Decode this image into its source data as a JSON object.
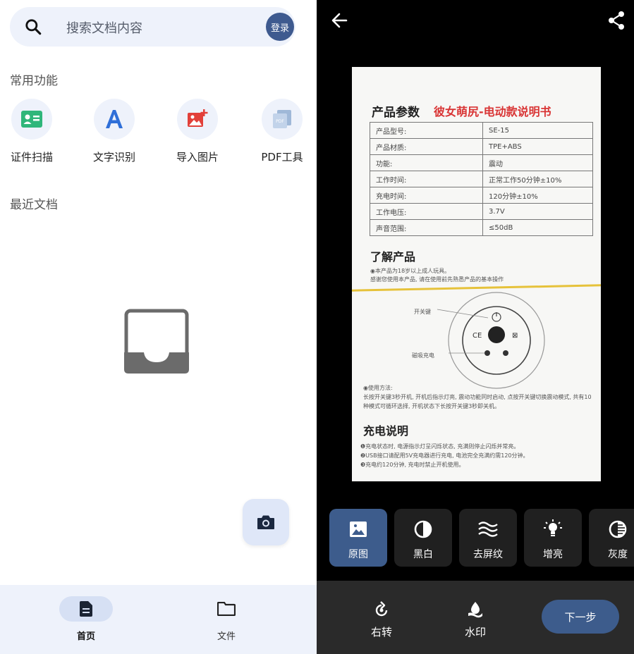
{
  "home": {
    "search": {
      "placeholder": "搜索文档内容",
      "icon": "search-icon"
    },
    "login_label": "登录",
    "common_title": "常用功能",
    "functions": [
      {
        "label": "证件扫描",
        "icon": "id-card-icon",
        "color": "#2fb67a"
      },
      {
        "label": "文字识别",
        "icon": "text-a-icon",
        "color": "#2f6fd8"
      },
      {
        "label": "导入图片",
        "icon": "image-add-icon",
        "color": "#e2403a"
      },
      {
        "label": "PDF工具",
        "icon": "pdf-icon",
        "color": "#9fb8d8"
      }
    ],
    "recent_title": "最近文档",
    "fab_icon": "camera-icon",
    "nav": [
      {
        "label": "首页",
        "icon": "document-icon",
        "active": true
      },
      {
        "label": "文件",
        "icon": "folder-icon",
        "active": false
      }
    ]
  },
  "editor": {
    "back_icon": "arrow-left-icon",
    "share_icon": "share-icon",
    "document": {
      "title": "产品参数",
      "title_red": "彼女萌尻-电动款说明书",
      "rows": [
        {
          "k": "产品型号:",
          "v": "SE-15"
        },
        {
          "k": "产品材质:",
          "v": "TPE+ABS"
        },
        {
          "k": "功能:",
          "v": "震动"
        },
        {
          "k": "工作时间:",
          "v": "正常工作50分钟±10%"
        },
        {
          "k": "充电时间:",
          "v": "120分钟±10%"
        },
        {
          "k": "工作电压:",
          "v": "3.7V"
        },
        {
          "k": "声音范围:",
          "v": "≤50dB"
        }
      ],
      "section1": "了解产品",
      "section1_line1": "◉本产品为18岁以上成人玩具。",
      "section1_line2": "感谢您使用本产品, 请在使用前先熟悉产品的基本操作",
      "diagram_label1": "开关键",
      "diagram_label2": "磁吸充电",
      "usage_title": "◉使用方法:",
      "usage_text": "长按开关键3秒开机, 开机后指示灯亮, 震动功能同时启动, 点按开关键切换震动模式, 共有10种模式可循环选择, 开机状态下长按开关键3秒即关机。",
      "section2": "充电说明",
      "charge1": "❶充电状态时, 电源指示灯呈闪烁状态, 充满则停止闪烁并常亮。",
      "charge2": "❷USB接口请配用5V充电器进行充电, 电池完全充满约需120分钟。",
      "charge3": "❸充电约120分钟, 充电时禁止开机使用。"
    },
    "filters": [
      {
        "label": "原图",
        "icon": "image-icon",
        "active": true
      },
      {
        "label": "黑白",
        "icon": "contrast-icon",
        "active": false
      },
      {
        "label": "去屏纹",
        "icon": "waves-icon",
        "active": false
      },
      {
        "label": "增亮",
        "icon": "bulb-icon",
        "active": false
      },
      {
        "label": "灰度",
        "icon": "grayscale-icon",
        "active": false
      }
    ],
    "tools": [
      {
        "label": "右转",
        "icon": "rotate-right-icon"
      },
      {
        "label": "水印",
        "icon": "watermark-icon"
      }
    ],
    "next_label": "下一步"
  }
}
